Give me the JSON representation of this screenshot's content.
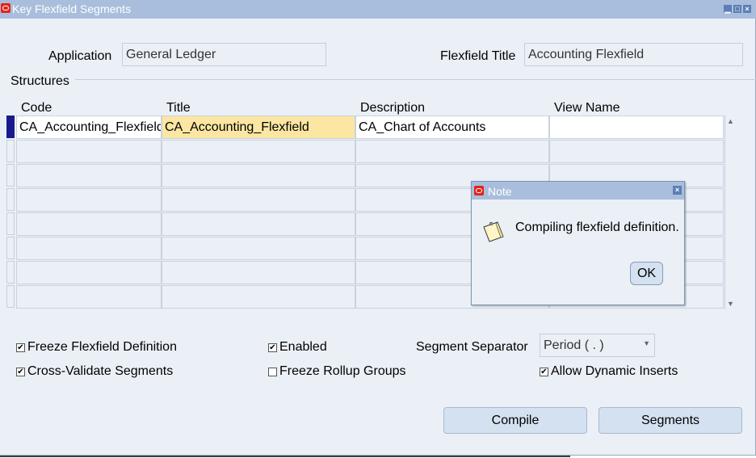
{
  "window": {
    "title": "Key Flexfield Segments"
  },
  "header": {
    "application_label": "Application",
    "application_value": "General Ledger",
    "flexfield_title_label": "Flexfield Title",
    "flexfield_title_value": "Accounting Flexfield"
  },
  "structures": {
    "label": "Structures",
    "columns": [
      "Code",
      "Title",
      "Description",
      "View Name"
    ],
    "rows": [
      [
        "CA_Accounting_Flexfield",
        "CA_Accounting_Flexfield",
        "CA_Chart of Accounts",
        ""
      ],
      [
        "",
        "",
        "",
        ""
      ],
      [
        "",
        "",
        "",
        ""
      ],
      [
        "",
        "",
        "",
        ""
      ],
      [
        "",
        "",
        "",
        ""
      ],
      [
        "",
        "",
        "",
        ""
      ],
      [
        "",
        "",
        "",
        ""
      ],
      [
        "",
        "",
        "",
        ""
      ]
    ]
  },
  "options": {
    "freeze_flexfield": {
      "label": "Freeze Flexfield Definition",
      "checked": true
    },
    "cross_validate": {
      "label": "Cross-Validate Segments",
      "checked": true
    },
    "enabled": {
      "label": "Enabled",
      "checked": true
    },
    "freeze_rollup": {
      "label": "Freeze Rollup Groups",
      "checked": false
    },
    "segment_separator_label": "Segment Separator",
    "segment_separator_value": "Period ( . )",
    "allow_dynamic_inserts": {
      "label": "Allow Dynamic Inserts",
      "checked": true
    }
  },
  "buttons": {
    "compile": "Compile",
    "segments": "Segments"
  },
  "note_dialog": {
    "title": "Note",
    "message": "Compiling flexfield definition.",
    "ok_label": "OK"
  },
  "colors": {
    "titlebar": "#a9bedc",
    "background": "#ebf0f7",
    "highlight_cell": "#fbe6a2",
    "brand_red": "#e3241b"
  }
}
